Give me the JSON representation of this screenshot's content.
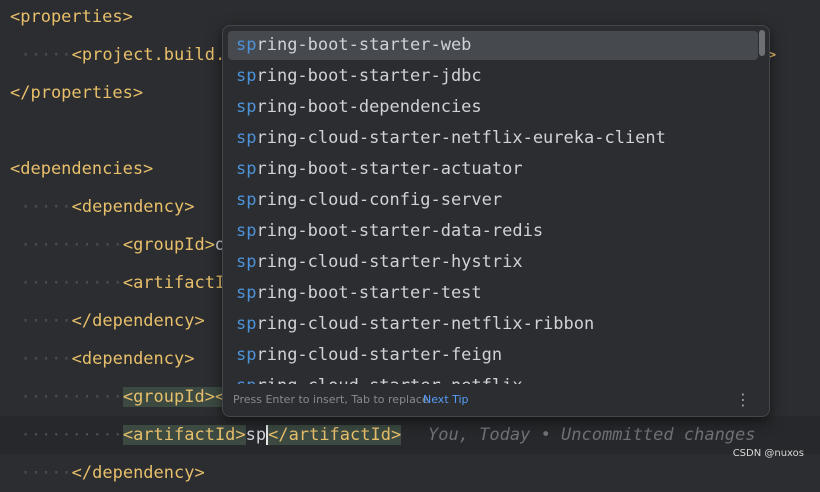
{
  "editor": {
    "lines": {
      "l1": {
        "open": "<properties>"
      },
      "l2": {
        "prefix": "<project.build.s",
        "suffix": ">"
      },
      "l3": {
        "close": "</properties>"
      },
      "l5": {
        "open": "<dependencies>"
      },
      "l6": {
        "open": "<dependency>"
      },
      "l7": {
        "tag": "<groupId>",
        "text": "org"
      },
      "l8": {
        "tag": "<artifactId>"
      },
      "l9": {
        "close": "</dependency>"
      },
      "l10": {
        "open": "<dependency>"
      },
      "l11": {
        "tag": "<groupId></"
      },
      "l12": {
        "open": "<artifactId>",
        "typed": "sp",
        "close": "</artifactId>",
        "blame": "You, Today • Uncommitted changes"
      },
      "l13": {
        "close": "</dependency>"
      }
    }
  },
  "completion": {
    "match": "sp",
    "items": [
      {
        "rest": "ring-boot-starter-web"
      },
      {
        "rest": "ring-boot-starter-jdbc"
      },
      {
        "rest": "ring-boot-dependencies"
      },
      {
        "rest": "ring-cloud-starter-netflix-eureka-client"
      },
      {
        "rest": "ring-boot-starter-actuator"
      },
      {
        "rest": "ring-cloud-config-server"
      },
      {
        "rest": "ring-boot-starter-data-redis"
      },
      {
        "rest": "ring-cloud-starter-hystrix"
      },
      {
        "rest": "ring-boot-starter-test"
      },
      {
        "rest": "ring-cloud-starter-netflix-ribbon"
      },
      {
        "rest": "ring-cloud-starter-feign"
      },
      {
        "rest": "ring-cloud-starter-netflix"
      }
    ],
    "footer": {
      "hint": "Press Enter to insert, Tab to replace",
      "next_tip": "Next Tip",
      "more_icon": "⋮"
    }
  },
  "watermark": "CSDN @nuxos"
}
